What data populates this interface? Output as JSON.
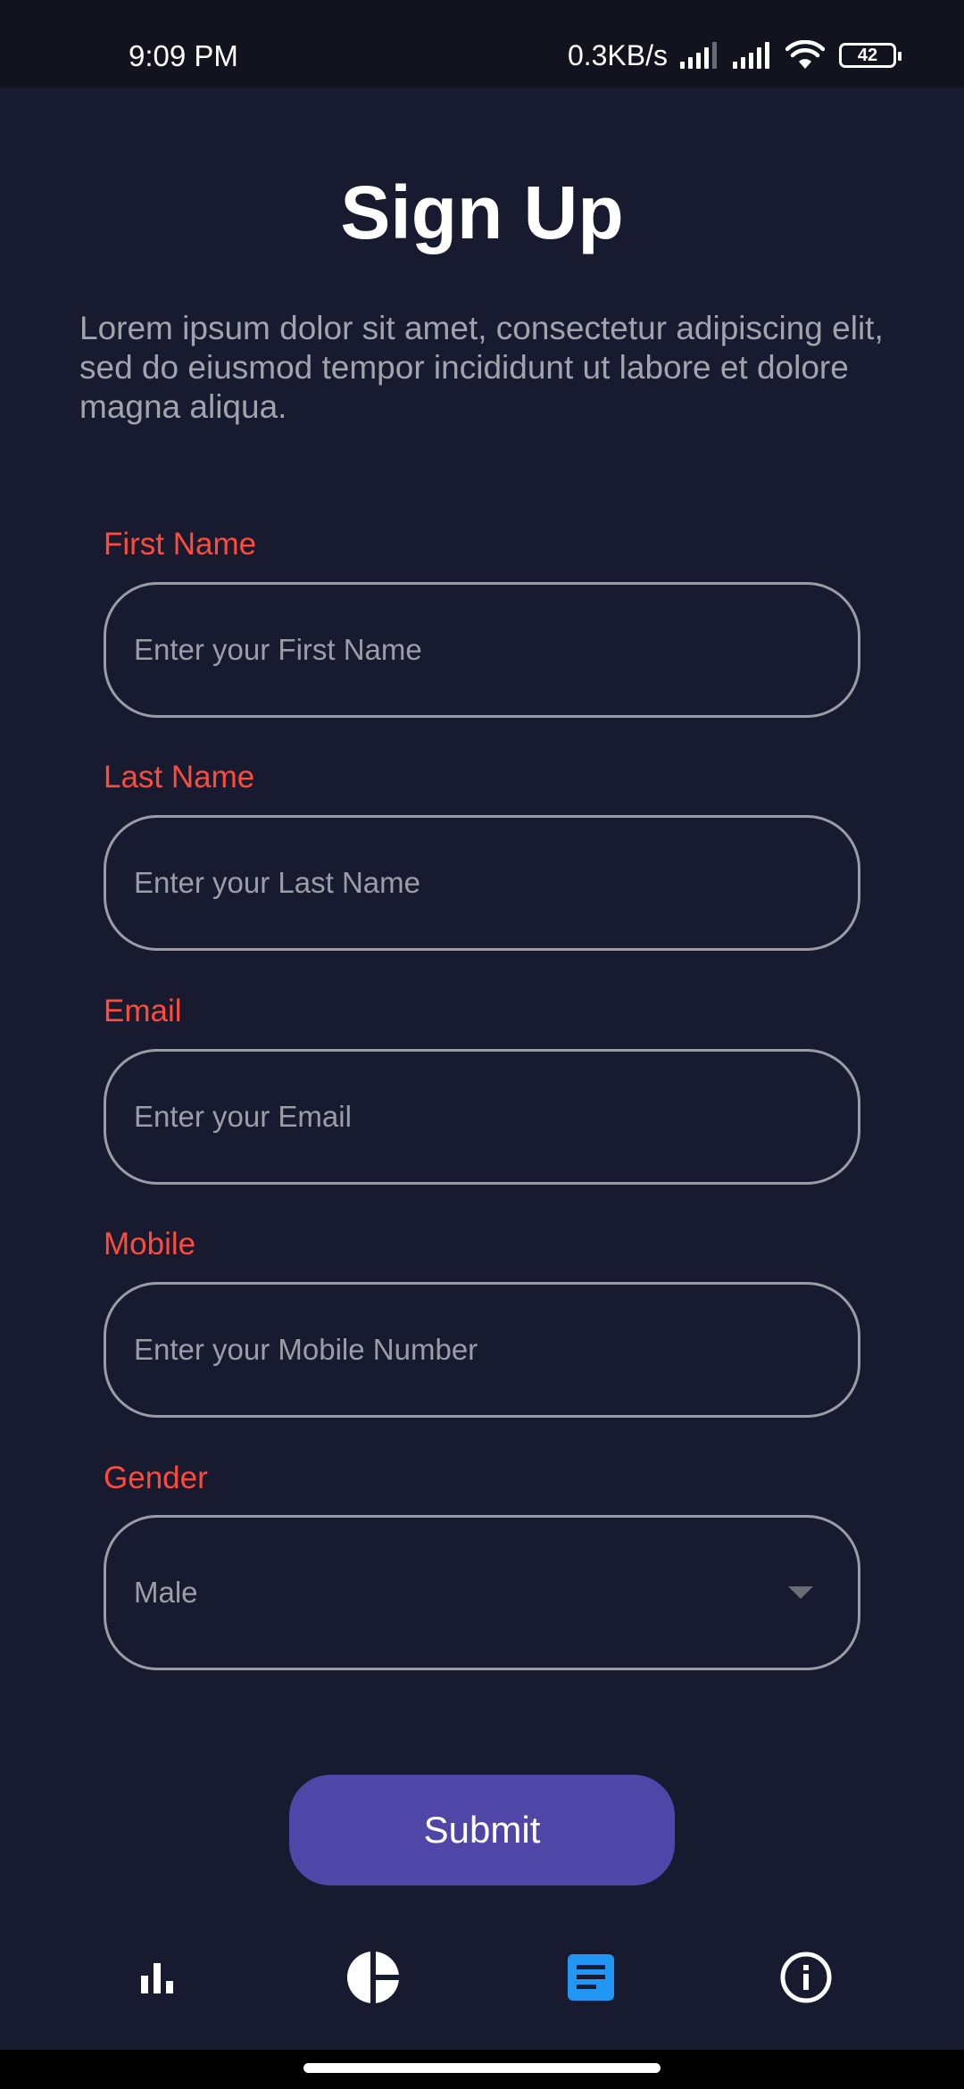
{
  "status_bar": {
    "time": "9:09 PM",
    "network_speed": "0.3KB/s",
    "battery_level": "42",
    "icons": [
      "signal-icon",
      "signal-icon",
      "wifi-icon",
      "battery-icon"
    ]
  },
  "header": {
    "title": "Sign Up",
    "description": "Lorem ipsum dolor sit amet, consectetur adipiscing elit, sed do eiusmod tempor incididunt ut labore et dolore magna aliqua."
  },
  "form": {
    "first_name": {
      "label": "First Name",
      "placeholder": "Enter your First Name",
      "value": ""
    },
    "last_name": {
      "label": "Last Name",
      "placeholder": "Enter your Last Name",
      "value": ""
    },
    "email": {
      "label": "Email",
      "placeholder": "Enter your Email",
      "value": ""
    },
    "mobile": {
      "label": "Mobile",
      "placeholder": "Enter your Mobile Number",
      "value": ""
    },
    "gender": {
      "label": "Gender",
      "selected": "Male",
      "icon": "chevron-down-icon"
    },
    "submit_label": "Submit"
  },
  "bottom_nav": {
    "items": [
      {
        "icon": "bar-chart-icon",
        "active": false
      },
      {
        "icon": "pie-chart-icon",
        "active": false
      },
      {
        "icon": "document-icon",
        "active": true
      },
      {
        "icon": "info-icon",
        "active": false
      }
    ]
  },
  "colors": {
    "background": "#181a2f",
    "status_bar": "#12131f",
    "label": "#ff4b3c",
    "field_border": "#9c9ca6",
    "placeholder": "#9d9da8",
    "button": "#5046a8",
    "nav_active": "#2196f3",
    "nav_inactive": "#ffffff"
  }
}
